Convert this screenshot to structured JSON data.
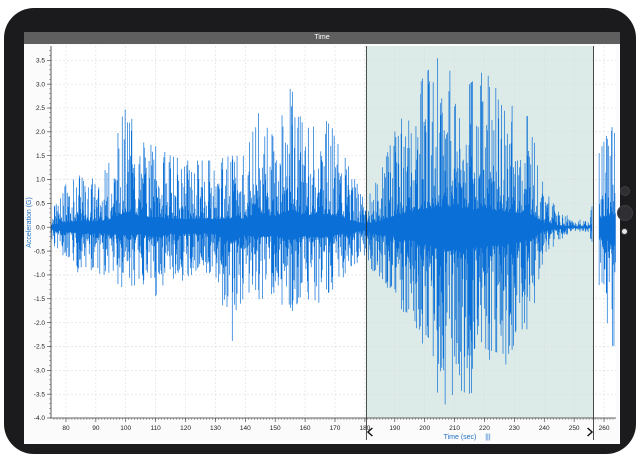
{
  "header": {
    "title": "Time"
  },
  "colors": {
    "signal": "#0a6fd6",
    "selection_fill": "#a9ccc6",
    "axis_label": "#1f6fc5",
    "device": "#1b1b1d"
  },
  "chart_data": {
    "type": "line",
    "title": "Time",
    "xlabel": "Time (sec)",
    "ylabel": "Acceleration (G)",
    "xlim": [
      75,
      264
    ],
    "ylim": [
      -4.0,
      3.8
    ],
    "grid": true,
    "x_ticks": [
      "80",
      "90",
      "100",
      "110",
      "120",
      "130",
      "140",
      "150",
      "160",
      "170",
      "180",
      "190",
      "200",
      "210",
      "220",
      "230",
      "240",
      "250",
      "260"
    ],
    "y_ticks": [
      "3.5",
      "3.0",
      "2.5",
      "2.0",
      "1.5",
      "1.0",
      "0.5",
      "0.0",
      "-0.5",
      "-1.0",
      "-1.5",
      "-2.0",
      "-2.5",
      "-3.0",
      "-3.5",
      "-4.0"
    ],
    "selection": {
      "x_start": 180.5,
      "x_end": 256.5
    },
    "annotation_marker": "|||",
    "series": [
      {
        "x": [
          75,
          80,
          85,
          90,
          95,
          100,
          105,
          110,
          115,
          120,
          125,
          130,
          135,
          140,
          145,
          150,
          155,
          160,
          165,
          170,
          175,
          180,
          185,
          190,
          195,
          200,
          205,
          210,
          215,
          220,
          225,
          230,
          235,
          240,
          245,
          250,
          255,
          258,
          262
        ],
        "min": [
          -0.3,
          -0.8,
          -1.1,
          -1.0,
          -1.2,
          -1.4,
          -1.2,
          -1.7,
          -1.1,
          -1.2,
          -1.0,
          -1.1,
          -2.6,
          -1.4,
          -1.6,
          -1.5,
          -2.2,
          -1.5,
          -1.8,
          -1.4,
          -0.9,
          -0.6,
          -1.3,
          -1.5,
          -2.2,
          -2.9,
          -3.8,
          -3.9,
          -3.7,
          -3.3,
          -3.1,
          -2.8,
          -2.2,
          -0.6,
          -0.3,
          -0.1,
          -0.1,
          -1.3,
          -2.6
        ],
        "max": [
          0.3,
          0.9,
          1.1,
          1.0,
          1.4,
          2.6,
          1.8,
          1.7,
          1.5,
          1.4,
          1.4,
          1.4,
          1.5,
          1.5,
          2.5,
          1.8,
          3.0,
          2.0,
          2.4,
          2.0,
          1.2,
          0.6,
          1.1,
          2.0,
          2.6,
          3.2,
          3.6,
          3.6,
          3.0,
          3.3,
          2.8,
          2.5,
          2.3,
          0.8,
          0.3,
          0.2,
          0.1,
          1.5,
          2.1
        ]
      }
    ]
  }
}
